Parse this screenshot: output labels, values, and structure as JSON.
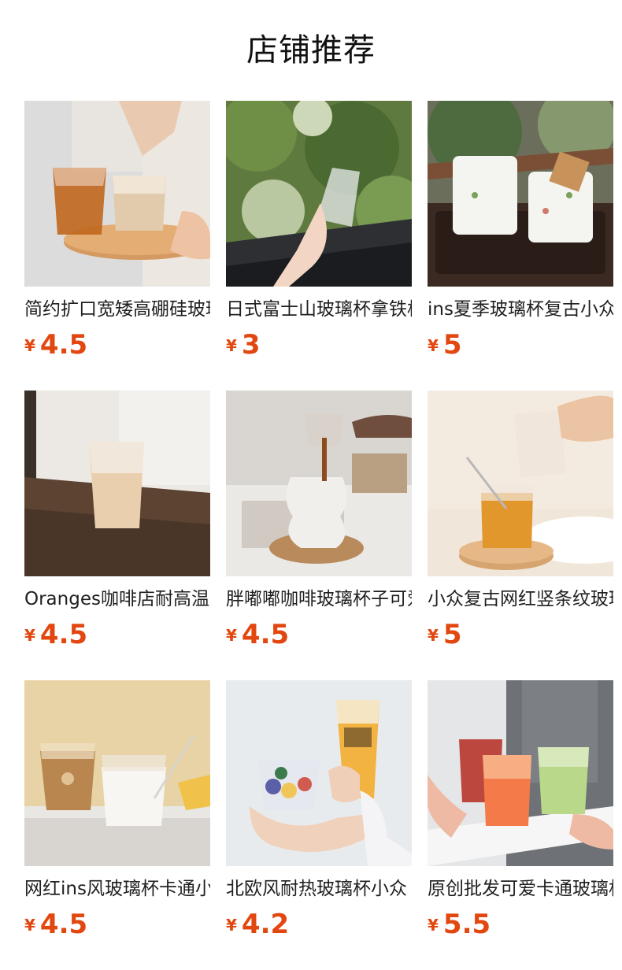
{
  "page": {
    "title": "店铺推荐"
  },
  "products": [
    {
      "name": "简约扩口宽矮高硼硅玻璃杯",
      "currency": "¥",
      "price": "4.5",
      "image": "glass-cups-on-wooden-tray"
    },
    {
      "name": "日式富士山玻璃杯拿铁杯",
      "currency": "¥",
      "price": "3",
      "image": "fuji-glass-held-by-window"
    },
    {
      "name": "ins夏季玻璃杯复古小众",
      "currency": "¥",
      "price": "5",
      "image": "milk-glasses-on-dark-tray"
    },
    {
      "name": "Oranges咖啡店耐高温玻璃杯",
      "currency": "¥",
      "price": "4.5",
      "image": "ribbed-latte-glass-on-shelf"
    },
    {
      "name": "胖嘟嘟咖啡玻璃杯子可爱",
      "currency": "¥",
      "price": "4.5",
      "image": "pouring-coffee-into-bubble-glass"
    },
    {
      "name": "小众复古网红竖条纹玻璃杯",
      "currency": "¥",
      "price": "5",
      "image": "striped-glass-with-straw"
    },
    {
      "name": "网红ins风玻璃杯卡通小熊",
      "currency": "¥",
      "price": "4.5",
      "image": "bear-glass-and-milk-glass"
    },
    {
      "name": "北欧风耐热玻璃杯小众",
      "currency": "¥",
      "price": "4.2",
      "image": "hands-holding-two-glasses"
    },
    {
      "name": "原创批发可爱卡通玻璃杯",
      "currency": "¥",
      "price": "5.5",
      "image": "colorful-drinks-on-tray"
    }
  ]
}
